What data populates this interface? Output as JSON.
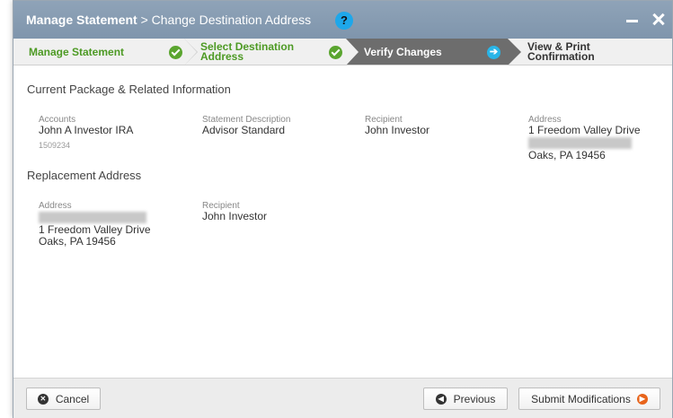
{
  "window": {
    "title_bold": "Manage Statement",
    "title_rest": " > Change Destination Address",
    "help_glyph": "?",
    "minimize_label": "",
    "close_label": ""
  },
  "steps": [
    {
      "line1": "Manage Statement",
      "line2": "",
      "state": "complete"
    },
    {
      "line1": "Select Destination",
      "line2": "Address",
      "state": "complete"
    },
    {
      "line1": "Verify Changes",
      "line2": "",
      "state": "current"
    },
    {
      "line1": "View & Print",
      "line2": "Confirmation",
      "state": "upcoming"
    }
  ],
  "current_package": {
    "heading": "Current Package & Related Information",
    "accounts_label": "Accounts",
    "accounts_value": "John A Investor IRA",
    "accounts_number": "1509234",
    "statement_label": "Statement Description",
    "statement_value": "Advisor Standard",
    "recipient_label": "Recipient",
    "recipient_value": "John Investor",
    "address_label": "Address",
    "address_line1": "1 Freedom Valley Drive",
    "address_line3": "Oaks, PA 19456"
  },
  "replacement": {
    "heading": "Replacement Address",
    "address_label": "Address",
    "address_line2": "1 Freedom Valley Drive",
    "address_line3": "Oaks, PA 19456",
    "recipient_label": "Recipient",
    "recipient_value": "John Investor"
  },
  "footer": {
    "cancel_label": "Cancel",
    "previous_label": "Previous",
    "submit_label": "Submit Modifications"
  },
  "colors": {
    "titlebar": "#8fa3b8",
    "complete": "#4d9a24",
    "current_bg": "#6d6d6d",
    "help": "#1ea7ea",
    "submit_icon": "#e8641b"
  },
  "icons": [
    "help-icon",
    "minimize-icon",
    "close-icon",
    "check-circle-icon",
    "arrow-right-circle-icon",
    "cancel-x-icon",
    "arrow-left-icon",
    "arrow-right-icon"
  ]
}
